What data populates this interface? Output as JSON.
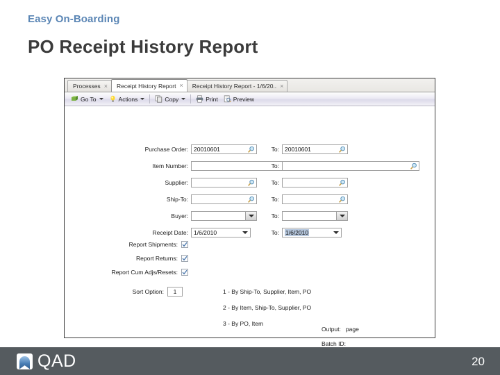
{
  "slide": {
    "eyebrow": "Easy On-Boarding",
    "title": "PO Receipt History Report",
    "page_number": "20",
    "brand": {
      "name": "QAD",
      "accent_color": "#5b86b5",
      "footer_color": "#555b5f",
      "title_color": "#3b3b3b"
    }
  },
  "window": {
    "tabs": [
      {
        "label": "Processes",
        "close": "×",
        "active": false
      },
      {
        "label": "Receipt History Report",
        "close": "×",
        "active": true
      },
      {
        "label": "Receipt History Report - 1/6/20..",
        "close": "×",
        "active": false
      }
    ],
    "toolbar": [
      {
        "icon": "go-to-icon",
        "label": "Go To",
        "caret": true
      },
      {
        "icon": "actions-bulb-icon",
        "label": "Actions",
        "caret": true
      },
      {
        "icon": "copy-icon",
        "label": "Copy",
        "caret": true
      },
      {
        "icon": "print-icon",
        "label": "Print",
        "caret": false
      },
      {
        "icon": "preview-icon",
        "label": "Preview",
        "caret": false
      }
    ],
    "form": {
      "fields": [
        {
          "label": "Purchase Order:",
          "value": "20010601",
          "to_label": "To:",
          "to_value": "20010601",
          "control": "lookup"
        },
        {
          "label": "Item Number:",
          "value": "",
          "to_label": "To:",
          "to_value": "",
          "control": "lookup"
        },
        {
          "label": "Supplier:",
          "value": "",
          "to_label": "To:",
          "to_value": "",
          "control": "lookup"
        },
        {
          "label": "Ship-To:",
          "value": "",
          "to_label": "To:",
          "to_value": "",
          "control": "lookup"
        },
        {
          "label": "Buyer:",
          "value": "",
          "to_label": "To:",
          "to_value": "",
          "control": "combo"
        },
        {
          "label": "Receipt Date:",
          "value": "1/6/2010",
          "to_label": "To:",
          "to_value": "1/6/2010",
          "control": "date"
        }
      ],
      "checkboxes": [
        {
          "label": "Report Shipments:",
          "checked": true
        },
        {
          "label": "Report Returns:",
          "checked": true
        },
        {
          "label": "Report Cum Adjs/Resets:",
          "checked": true
        }
      ],
      "sort": {
        "label": "Sort Option:",
        "value": "1",
        "options": [
          "1 - By Ship-To, Supplier, Item, PO",
          "2 - By Item, Ship-To, Supplier, PO",
          "3 - By PO, Item"
        ]
      },
      "output": {
        "label": "Output:",
        "value": "page"
      },
      "batch": {
        "label": "Batch ID:",
        "value": ""
      }
    }
  }
}
